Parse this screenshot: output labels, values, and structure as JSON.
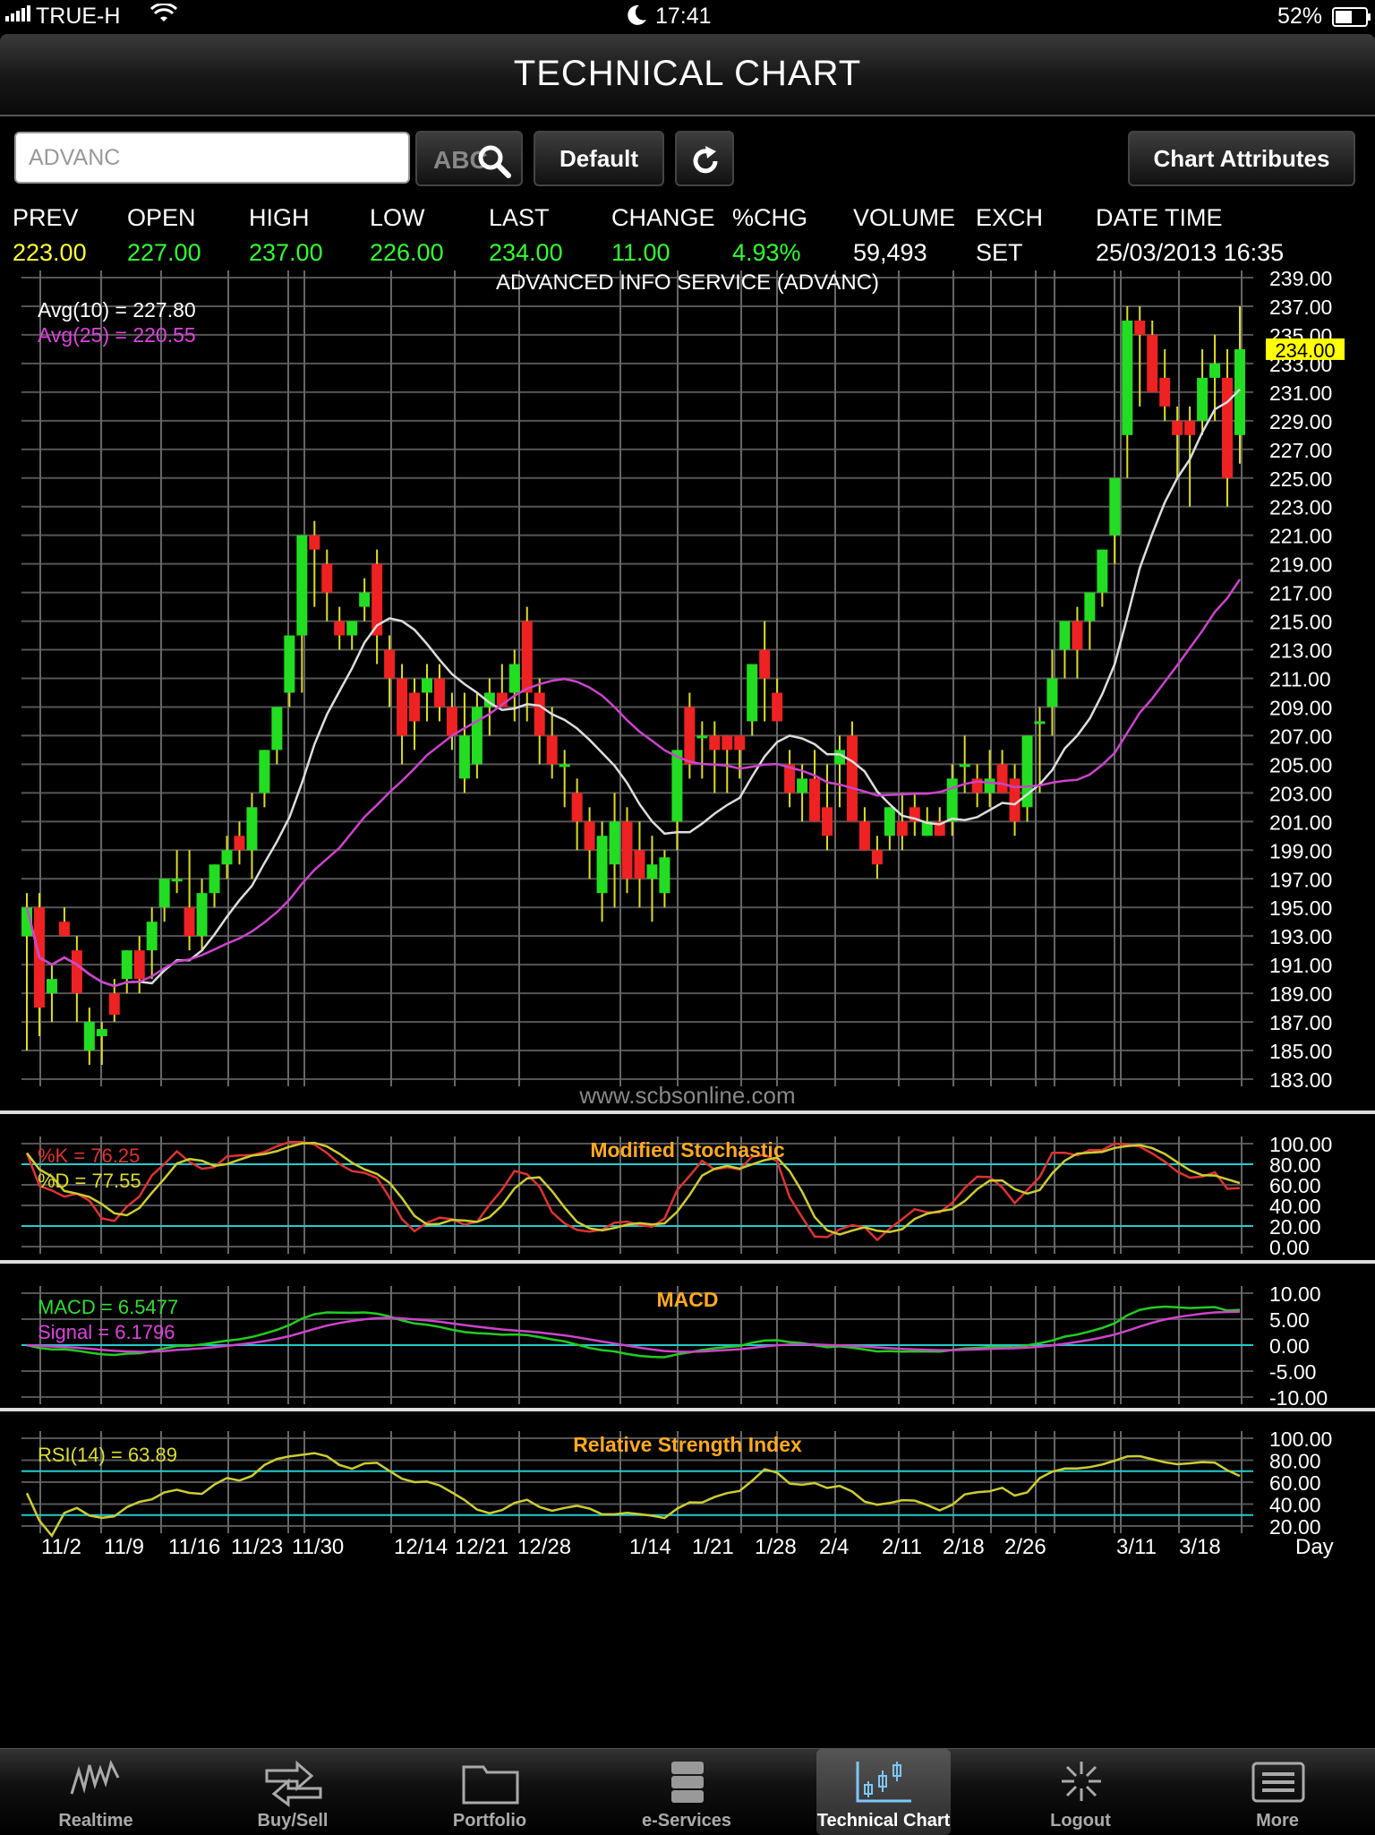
{
  "status_bar": {
    "carrier": "TRUE-H",
    "time": "17:41",
    "battery": "52%"
  },
  "header": {
    "title": "TECHNICAL CHART"
  },
  "toolbar": {
    "search_value": "ADVANC",
    "abc_label": "ABC",
    "default_label": "Default",
    "attributes_label": "Chart Attributes"
  },
  "quote": {
    "headers": [
      "PREV",
      "OPEN",
      "HIGH",
      "LOW",
      "LAST",
      "CHANGE",
      "%CHG",
      "VOLUME",
      "EXCH",
      "DATE TIME"
    ],
    "values": [
      "223.00",
      "227.00",
      "237.00",
      "226.00",
      "234.00",
      "11.00",
      "4.93%",
      "59,493",
      "SET",
      "25/03/2013 16:35"
    ],
    "value_colors": [
      "#ffff33",
      "#33ff33",
      "#33ff33",
      "#33ff33",
      "#33ff33",
      "#33ff33",
      "#33ff33",
      "#ffffff",
      "#ffffff",
      "#ffffff"
    ]
  },
  "chart_data": [
    {
      "type": "candlestick",
      "title": "ADVANCED INFO SERVICE (ADVANC)",
      "watermark": "www.scbsonline.com",
      "ylim": [
        183,
        239
      ],
      "yticks": [
        "239.00",
        "237.00",
        "235.00",
        "233.00",
        "231.00",
        "229.00",
        "227.00",
        "225.00",
        "223.00",
        "221.00",
        "219.00",
        "217.00",
        "215.00",
        "213.00",
        "211.00",
        "209.00",
        "207.00",
        "205.00",
        "203.00",
        "201.00",
        "199.00",
        "197.00",
        "195.00",
        "193.00",
        "191.00",
        "189.00",
        "187.00",
        "185.00",
        "183.00"
      ],
      "last_value": "234.00",
      "legend": [
        {
          "text": "Avg(10)  =  227.80",
          "color": "#ffffff"
        },
        {
          "text": "Avg(25)  =  220.55",
          "color": "#dd44dd"
        }
      ],
      "x_ticks": [
        "11/2",
        "11/9",
        "11/16",
        "11/23",
        "11/30",
        "12/14",
        "12/21",
        "12/28",
        "1/14",
        "1/21",
        "1/28",
        "2/4",
        "2/11",
        "2/18",
        "2/26",
        "3/11",
        "3/18"
      ],
      "x_unit": "Day",
      "candles": [
        [
          193,
          196,
          185,
          195
        ],
        [
          195,
          196,
          186,
          188
        ],
        [
          189,
          191,
          187,
          190
        ],
        [
          194,
          195,
          193,
          193
        ],
        [
          192,
          193,
          187,
          189
        ],
        [
          185,
          188,
          184,
          187
        ],
        [
          186,
          187,
          184,
          186.5
        ],
        [
          189,
          190,
          187,
          187.5
        ],
        [
          190,
          192,
          189,
          192
        ],
        [
          192,
          193,
          189,
          190
        ],
        [
          192,
          195,
          190,
          194
        ],
        [
          195,
          197,
          194,
          197
        ],
        [
          197,
          199,
          196,
          197
        ],
        [
          195,
          199,
          192,
          193
        ],
        [
          193,
          197,
          192,
          196
        ],
        [
          196,
          198,
          195,
          198
        ],
        [
          198,
          200,
          197,
          199
        ],
        [
          200,
          201,
          198,
          199
        ],
        [
          199,
          203,
          197,
          202
        ],
        [
          203,
          206,
          202,
          206
        ],
        [
          206,
          209,
          205,
          209
        ],
        [
          210,
          213,
          209,
          214
        ],
        [
          214,
          221,
          210,
          221
        ],
        [
          221,
          222,
          216,
          220
        ],
        [
          219,
          220,
          215,
          217
        ],
        [
          215,
          216,
          213,
          214
        ],
        [
          214,
          215,
          213,
          215
        ],
        [
          216,
          218,
          215,
          217
        ],
        [
          219,
          220,
          212,
          214
        ],
        [
          213,
          214,
          209,
          211
        ],
        [
          211,
          212,
          205,
          207
        ],
        [
          210,
          211,
          206,
          208
        ],
        [
          210,
          212,
          208,
          211
        ],
        [
          211,
          212,
          208,
          209
        ],
        [
          209,
          210,
          206,
          207
        ],
        [
          204,
          210,
          203,
          207
        ],
        [
          205,
          210,
          204,
          209
        ],
        [
          209,
          211,
          207,
          210
        ],
        [
          210,
          212,
          209,
          209
        ],
        [
          210,
          213,
          208,
          212
        ],
        [
          215,
          216,
          208,
          210
        ],
        [
          210,
          211,
          205,
          207
        ],
        [
          207,
          209,
          204,
          205
        ],
        [
          205,
          206,
          202,
          205
        ],
        [
          203,
          204,
          199,
          201
        ],
        [
          201,
          202,
          197,
          199
        ],
        [
          196,
          201,
          194,
          200
        ],
        [
          198,
          203,
          195,
          201
        ],
        [
          201,
          202,
          196,
          197
        ],
        [
          199,
          201,
          195,
          197
        ],
        [
          197,
          200,
          194,
          198
        ],
        [
          196,
          199,
          195,
          198.5
        ],
        [
          201,
          206,
          199,
          206
        ],
        [
          209,
          210,
          204,
          205
        ],
        [
          207,
          208,
          204,
          207
        ],
        [
          207,
          208,
          203,
          206
        ],
        [
          207,
          207,
          203,
          206
        ],
        [
          207,
          207,
          204,
          206
        ],
        [
          208,
          209,
          207,
          212
        ],
        [
          213,
          215,
          208,
          211
        ],
        [
          210,
          211,
          209,
          208
        ],
        [
          205,
          206,
          202,
          203
        ],
        [
          203,
          205,
          201,
          204
        ],
        [
          204,
          206,
          201,
          201
        ],
        [
          202,
          205,
          199,
          200
        ],
        [
          205,
          207,
          202,
          206
        ],
        [
          207,
          208,
          202,
          201
        ],
        [
          201,
          202,
          199,
          199
        ],
        [
          199,
          200,
          197,
          198
        ],
        [
          200,
          202,
          199,
          202
        ],
        [
          201,
          203,
          199,
          200
        ],
        [
          202,
          203,
          200,
          201
        ],
        [
          200,
          202,
          200,
          201
        ],
        [
          201,
          202,
          200,
          200
        ],
        [
          201,
          205,
          200,
          204
        ],
        [
          205,
          207,
          203,
          205
        ],
        [
          204,
          205,
          202,
          203
        ],
        [
          203,
          206,
          202,
          204
        ],
        [
          205,
          206,
          203,
          203
        ],
        [
          204,
          205,
          200,
          201
        ],
        [
          202,
          207,
          201,
          207
        ],
        [
          208,
          209,
          203,
          208
        ],
        [
          209,
          213,
          207,
          211
        ],
        [
          213,
          215,
          211,
          215
        ],
        [
          215,
          216,
          211,
          213
        ],
        [
          215,
          217,
          213,
          217
        ],
        [
          217,
          220,
          216,
          220
        ],
        [
          221,
          225,
          219,
          225
        ],
        [
          228,
          237,
          225,
          236
        ],
        [
          236,
          237,
          230,
          235
        ],
        [
          235,
          236,
          231,
          231
        ],
        [
          232,
          234,
          229,
          230
        ],
        [
          229,
          230,
          225,
          228
        ],
        [
          229,
          230,
          223,
          228
        ],
        [
          229,
          234,
          228,
          232
        ],
        [
          232,
          235,
          229,
          233
        ],
        [
          232,
          234,
          223,
          225
        ],
        [
          228,
          237,
          226,
          234
        ]
      ]
    },
    {
      "type": "line",
      "title": "Modified Stochastic",
      "ylim": [
        0,
        100
      ],
      "yticks": [
        "100.00",
        "80.00",
        "60.00",
        "40.00",
        "20.00",
        "0.00"
      ],
      "legend": [
        {
          "text": "%K  =  76.25",
          "color": "#dd3333"
        },
        {
          "text": "%D  =  77.55",
          "color": "#dddd33"
        }
      ]
    },
    {
      "type": "line",
      "title": "MACD",
      "ylim": [
        -10,
        10
      ],
      "yticks": [
        "10.00",
        "5.00",
        "0.00",
        "-5.00",
        "-10.00"
      ],
      "legend": [
        {
          "text": "MACD  =  6.5477",
          "color": "#33dd33"
        },
        {
          "text": "Signal  =  6.1796",
          "color": "#dd44dd"
        }
      ]
    },
    {
      "type": "line",
      "title": "Relative Strength Index",
      "ylim": [
        20,
        100
      ],
      "yticks": [
        "100.00",
        "80.00",
        "60.00",
        "40.00",
        "20.00"
      ],
      "legend": [
        {
          "text": "RSI(14)  =  63.89",
          "color": "#dddd33"
        }
      ]
    }
  ],
  "tabs": [
    "Realtime",
    "Buy/Sell",
    "Portfolio",
    "e-Services",
    "Technical Chart",
    "Logout",
    "More"
  ],
  "active_tab": "Technical Chart"
}
